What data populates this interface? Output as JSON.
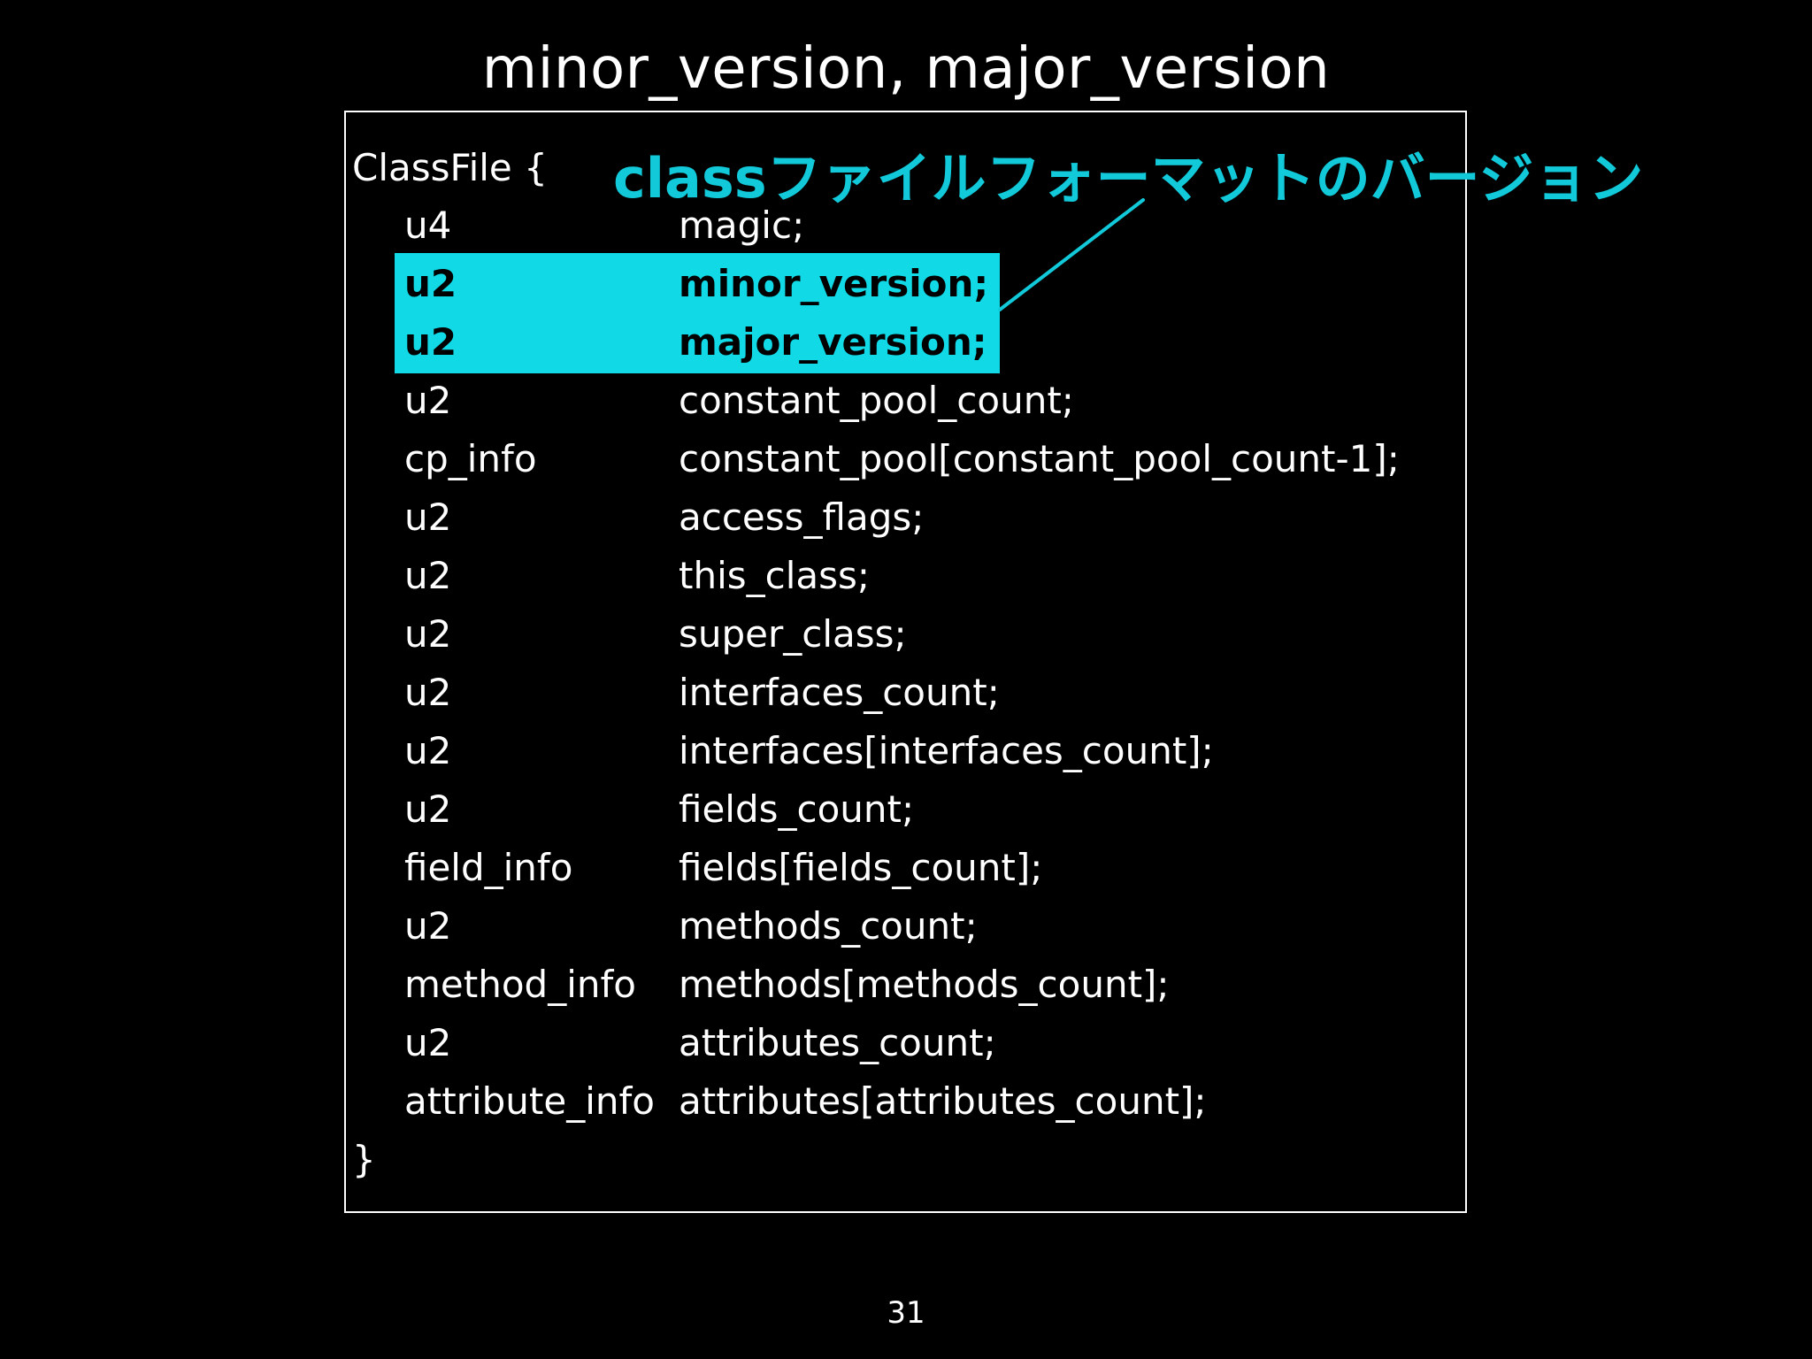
{
  "slide": {
    "title": "minor_version, major_version",
    "page_number": "31"
  },
  "annotation": {
    "text": "classファイルフォーマットのバージョン",
    "color": "#11c9d8"
  },
  "highlight_color": "#11d9e6",
  "code": {
    "open": "ClassFile {",
    "close": "}",
    "fields": [
      {
        "type": "u4",
        "name": "magic;",
        "highlighted": false
      },
      {
        "type": "u2",
        "name": "minor_version;",
        "highlighted": true
      },
      {
        "type": "u2",
        "name": "major_version;",
        "highlighted": true
      },
      {
        "type": "u2",
        "name": "constant_pool_count;",
        "highlighted": false
      },
      {
        "type": "cp_info",
        "name": "constant_pool[constant_pool_count-1];",
        "highlighted": false
      },
      {
        "type": "u2",
        "name": "access_flags;",
        "highlighted": false
      },
      {
        "type": "u2",
        "name": "this_class;",
        "highlighted": false
      },
      {
        "type": "u2",
        "name": "super_class;",
        "highlighted": false
      },
      {
        "type": "u2",
        "name": "interfaces_count;",
        "highlighted": false
      },
      {
        "type": "u2",
        "name": "interfaces[interfaces_count];",
        "highlighted": false
      },
      {
        "type": "u2",
        "name": "fields_count;",
        "highlighted": false
      },
      {
        "type": "field_info",
        "name": "fields[fields_count];",
        "highlighted": false
      },
      {
        "type": "u2",
        "name": "methods_count;",
        "highlighted": false
      },
      {
        "type": "method_info",
        "name": "methods[methods_count];",
        "highlighted": false
      },
      {
        "type": "u2",
        "name": "attributes_count;",
        "highlighted": false
      },
      {
        "type": "attribute_info",
        "name": "attributes[attributes_count];",
        "highlighted": false
      }
    ]
  }
}
